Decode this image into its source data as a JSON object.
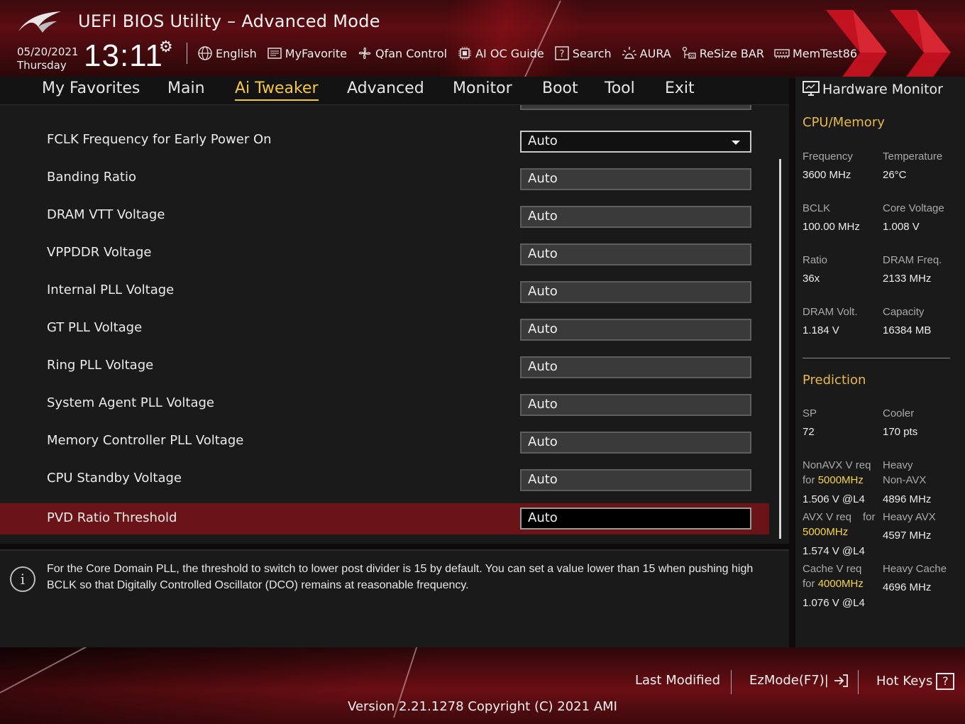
{
  "header": {
    "app_title": "UEFI BIOS Utility – Advanced Mode",
    "date": "05/20/2021",
    "weekday": "Thursday",
    "time": "13:11",
    "toolbar": [
      {
        "label": "English",
        "icon": "globe-icon"
      },
      {
        "label": "MyFavorite",
        "icon": "favorite-icon"
      },
      {
        "label": "Qfan Control",
        "icon": "fan-icon"
      },
      {
        "label": "AI OC Guide",
        "icon": "chip-icon"
      },
      {
        "label": "Search",
        "icon": "question-box-icon"
      },
      {
        "label": "AURA",
        "icon": "aura-icon"
      },
      {
        "label": "ReSize BAR",
        "icon": "resize-bar-icon"
      },
      {
        "label": "MemTest86",
        "icon": "memory-icon"
      }
    ]
  },
  "menu": {
    "items": [
      "My Favorites",
      "Main",
      "Ai Tweaker",
      "Advanced",
      "Monitor",
      "Boot",
      "Tool",
      "Exit"
    ],
    "active": "Ai Tweaker"
  },
  "settings": [
    {
      "label": "FCLK Frequency for Early Power On",
      "value": "Auto",
      "type": "dropdown"
    },
    {
      "label": "Banding Ratio",
      "value": "Auto",
      "type": "field"
    },
    {
      "label": "DRAM VTT Voltage",
      "value": "Auto",
      "type": "field"
    },
    {
      "label": "VPPDDR Voltage",
      "value": "Auto",
      "type": "field"
    },
    {
      "label": "Internal PLL Voltage",
      "value": "Auto",
      "type": "field"
    },
    {
      "label": "GT PLL Voltage",
      "value": "Auto",
      "type": "field"
    },
    {
      "label": "Ring PLL Voltage",
      "value": "Auto",
      "type": "field"
    },
    {
      "label": "System Agent PLL Voltage",
      "value": "Auto",
      "type": "field"
    },
    {
      "label": "Memory Controller PLL Voltage",
      "value": "Auto",
      "type": "field"
    },
    {
      "label": "CPU Standby Voltage",
      "value": "Auto",
      "type": "field"
    },
    {
      "label": "PVD Ratio Threshold",
      "value": "Auto",
      "type": "field",
      "selected": true
    }
  ],
  "info": {
    "text": "For the Core Domain PLL, the threshold to switch to lower post divider is 15 by default. You can set a value lower than 15 when pushing high BCLK so that Digitally Controlled Oscillator (DCO) remains at reasonable frequency."
  },
  "hardware_monitor": {
    "title": "Hardware Monitor",
    "cpu_memory": {
      "title": "CPU/Memory",
      "frequency_label": "Frequency",
      "frequency": "3600 MHz",
      "temperature_label": "Temperature",
      "temperature": "26°C",
      "bclk_label": "BCLK",
      "bclk": "100.00 MHz",
      "core_voltage_label": "Core Voltage",
      "core_voltage": "1.008 V",
      "ratio_label": "Ratio",
      "ratio": "36x",
      "dram_freq_label": "DRAM Freq.",
      "dram_freq": "2133 MHz",
      "dram_volt_label": "DRAM Volt.",
      "dram_volt": "1.184 V",
      "capacity_label": "Capacity",
      "capacity": "16384 MB"
    },
    "prediction": {
      "title": "Prediction",
      "sp_label": "SP",
      "sp": "72",
      "cooler_label": "Cooler",
      "cooler": "170 pts",
      "nonavx_req_label": "NonAVX V req",
      "for_label": "for",
      "nonavx_freq": "5000MHz",
      "nonavx_v": "1.506 V @L4",
      "heavy_nonavx_label_1": "Heavy",
      "heavy_nonavx_label_2": "Non-AVX",
      "heavy_nonavx": "4896 MHz",
      "avx_req_label": "AVX V req",
      "avx_for_label": "for",
      "avx_freq": "5000MHz",
      "avx_v": "1.574 V @L4",
      "heavy_avx_label": "Heavy AVX",
      "heavy_avx": "4597 MHz",
      "cache_req_label": "Cache V req",
      "cache_freq": "4000MHz",
      "cache_v": "1.076 V @L4",
      "heavy_cache_label": "Heavy Cache",
      "heavy_cache": "4696 MHz"
    }
  },
  "footer": {
    "last_modified": "Last Modified",
    "ezmode": "EzMode(F7)|",
    "hot_keys": "Hot Keys",
    "hot_keys_box": "?",
    "version": "Version 2.21.1278 Copyright (C) 2021 AMI"
  },
  "colors": {
    "accent": "#f5c842",
    "selected_row": "#6a1418",
    "section_title": "#e7b84a",
    "highlight_freq": "#f5d548"
  }
}
